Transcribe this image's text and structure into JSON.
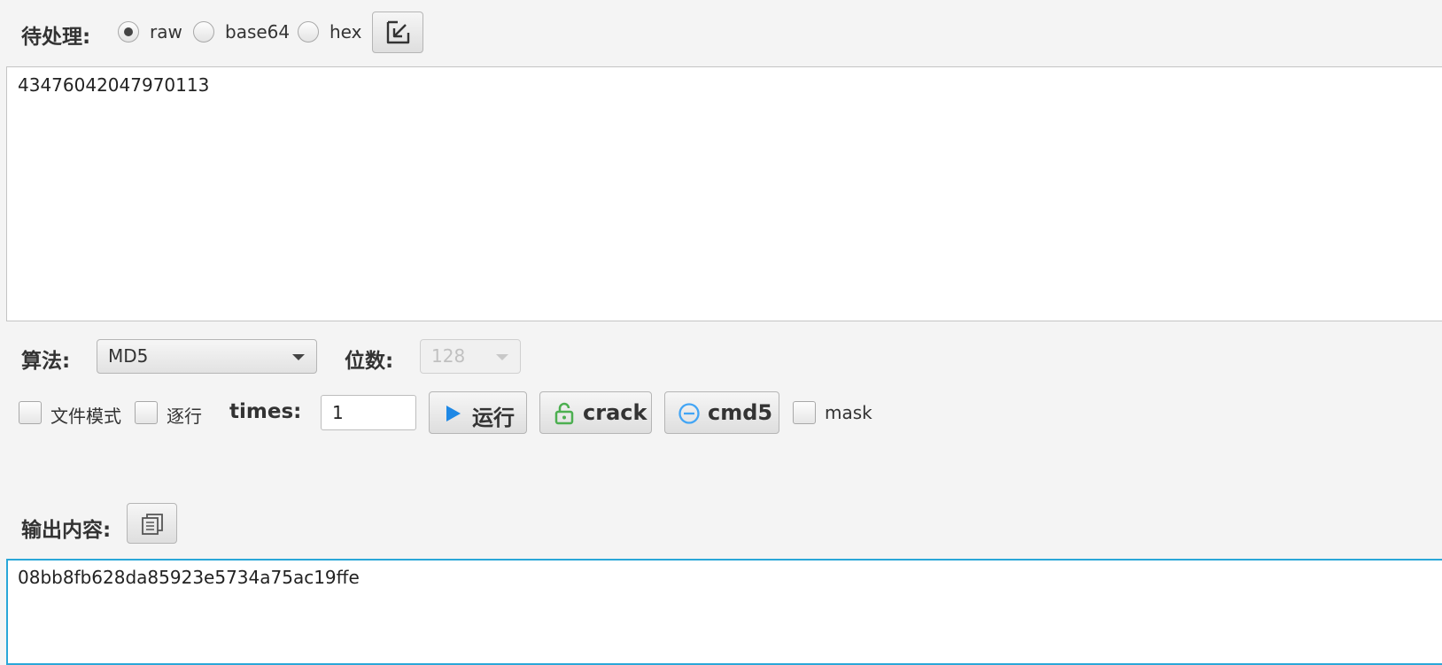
{
  "input_section": {
    "label": "待处理:",
    "encoding_options": [
      {
        "label": "raw",
        "selected": true
      },
      {
        "label": "base64",
        "selected": false
      },
      {
        "label": "hex",
        "selected": false
      }
    ],
    "import_icon": "arrow-down-left-icon",
    "text": "43476042047970113"
  },
  "settings": {
    "algorithm_label": "算法:",
    "algorithm_value": "MD5",
    "bits_label": "位数:",
    "bits_value": "128"
  },
  "options": {
    "file_mode_label": "文件模式",
    "file_mode_checked": false,
    "line_by_line_label": "逐行",
    "line_by_line_checked": false,
    "times_label": "times:",
    "times_value": "1",
    "run_label": "运行",
    "run_icon": "play-icon",
    "crack_label": "crack",
    "crack_icon": "unlock-icon",
    "cmd5_label": "cmd5",
    "cmd5_icon": "cmd5-icon",
    "mask_label": "mask",
    "mask_checked": false
  },
  "output_section": {
    "label": "输出内容:",
    "copy_icon": "copy-icon",
    "text": "08bb8fb628da85923e5734a75ac19ffe"
  },
  "colors": {
    "run_icon": "#1e88e5",
    "crack_icon": "#4caf50",
    "cmd5_icon": "#42a5f5",
    "focus_border": "#2aa7d8"
  }
}
